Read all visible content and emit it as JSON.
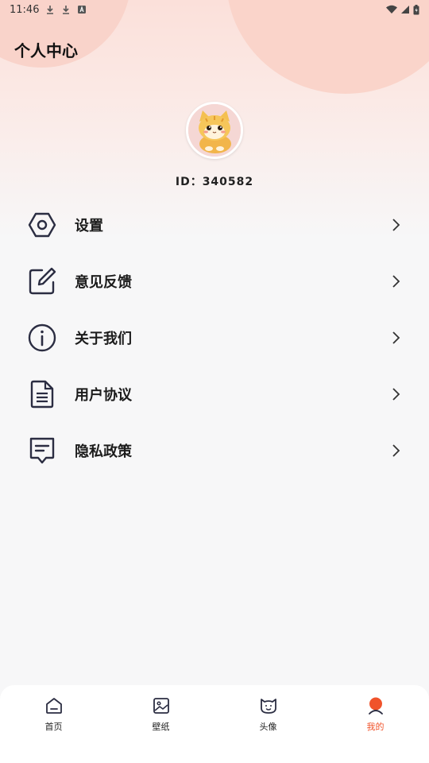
{
  "status_bar": {
    "time": "11:46"
  },
  "header": {
    "title": "个人中心"
  },
  "profile": {
    "id_text": "ID：340582"
  },
  "menu": {
    "items": [
      {
        "label": "设置",
        "icon": "hexagon-settings-icon"
      },
      {
        "label": "意见反馈",
        "icon": "edit-feedback-icon"
      },
      {
        "label": "关于我们",
        "icon": "info-icon"
      },
      {
        "label": "用户协议",
        "icon": "document-icon"
      },
      {
        "label": "隐私政策",
        "icon": "privacy-message-icon"
      }
    ]
  },
  "tabbar": {
    "tabs": [
      {
        "label": "首页",
        "icon": "home-icon",
        "active": false
      },
      {
        "label": "壁纸",
        "icon": "image-icon",
        "active": false
      },
      {
        "label": "头像",
        "icon": "face-icon",
        "active": false
      },
      {
        "label": "我的",
        "icon": "person-icon",
        "active": true
      }
    ]
  },
  "colors": {
    "accent": "#f0532b",
    "header_bg": "#fbe0da",
    "icon_stroke": "#2b2d42"
  }
}
